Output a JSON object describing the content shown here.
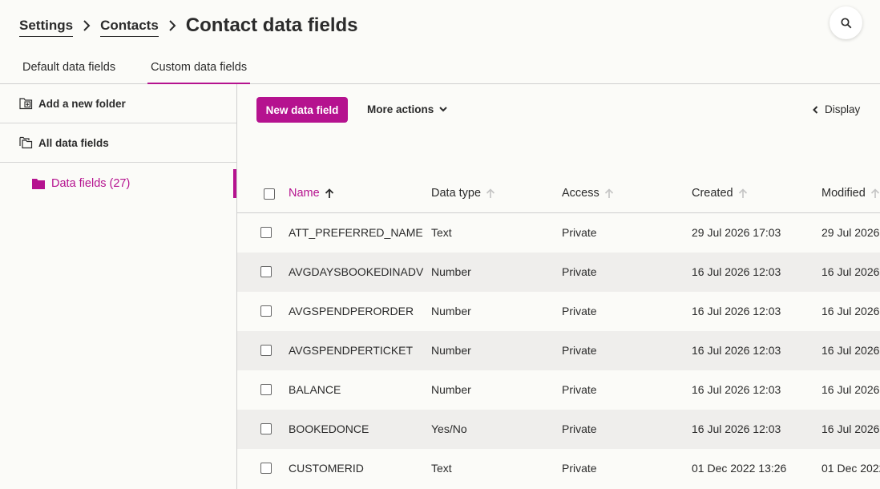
{
  "breadcrumb": {
    "items": [
      "Settings",
      "Contacts"
    ],
    "title": "Contact data fields"
  },
  "tabs": [
    {
      "label": "Default data fields",
      "active": false
    },
    {
      "label": "Custom data fields",
      "active": true
    }
  ],
  "sidebar": {
    "add_folder": "Add a new folder",
    "all_fields": "All data fields",
    "folders": [
      {
        "label": "Data fields (27)"
      }
    ]
  },
  "toolbar": {
    "new_field": "New data field",
    "more_actions": "More actions",
    "display": "Display"
  },
  "colors": {
    "accent": "#b5128f",
    "row_alt": "#efeeec",
    "background": "#fbfbf8"
  },
  "table": {
    "columns": [
      "Name",
      "Data type",
      "Access",
      "Created",
      "Modified"
    ],
    "sorted_column": "Name",
    "sort_direction": "ascending",
    "rows": [
      [
        "ATT_PREFERRED_NAME",
        "Text",
        "Private",
        "29 Jul 2026 17:03",
        "29 Jul 2026"
      ],
      [
        "AVGDAYSBOOKEDINADV",
        "Number",
        "Private",
        "16 Jul 2026 12:03",
        "16 Jul 2026"
      ],
      [
        "AVGSPENDPERORDER",
        "Number",
        "Private",
        "16 Jul 2026 12:03",
        "16 Jul 2026"
      ],
      [
        "AVGSPENDPERTICKET",
        "Number",
        "Private",
        "16 Jul 2026 12:03",
        "16 Jul 2026"
      ],
      [
        "BALANCE",
        "Number",
        "Private",
        "16 Jul 2026 12:03",
        "16 Jul 2026"
      ],
      [
        "BOOKEDONCE",
        "Yes/No",
        "Private",
        "16 Jul 2026 12:03",
        "16 Jul 2026"
      ],
      [
        "CUSTOMERID",
        "Text",
        "Private",
        "01 Dec 2022 13:26",
        "01 Dec 2022"
      ]
    ]
  }
}
